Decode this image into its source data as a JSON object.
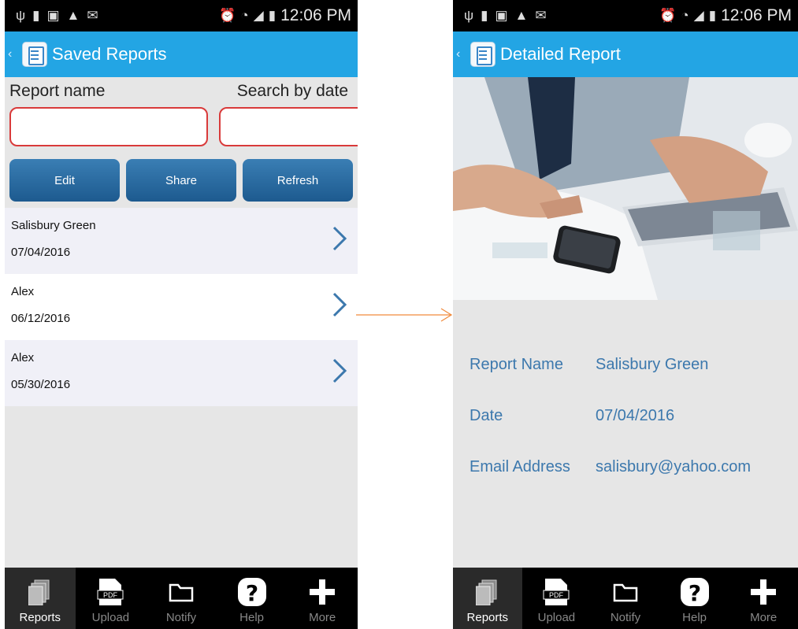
{
  "status_bar": {
    "time": "12:06 PM"
  },
  "left_screen": {
    "title": "Saved Reports",
    "search": {
      "report_name_label": "Report name",
      "date_label": "Search by date",
      "report_name_value": "",
      "date_value": ""
    },
    "buttons": {
      "edit": "Edit",
      "share": "Share",
      "refresh": "Refresh"
    },
    "reports": [
      {
        "name": "Salisbury Green",
        "date": "07/04/2016"
      },
      {
        "name": "Alex",
        "date": "06/12/2016"
      },
      {
        "name": "Alex",
        "date": "05/30/2016"
      }
    ]
  },
  "right_screen": {
    "title": "Detailed Report",
    "details": {
      "report_name_label": "Report Name",
      "report_name": "Salisbury Green",
      "date_label": "Date",
      "date": "07/04/2016",
      "email_label": "Email Address",
      "email": "salisbury@yahoo.com"
    }
  },
  "nav": {
    "reports": "Reports",
    "upload": "Upload",
    "notify": "Notify",
    "help": "Help",
    "more": "More",
    "pdf_badge": "PDF"
  },
  "colors": {
    "title_bar": "#23a5e4",
    "button": "#2a6ca3",
    "input_border": "#d93a3a",
    "detail_text": "#3c78ad",
    "arrow": "#f08a3c"
  }
}
